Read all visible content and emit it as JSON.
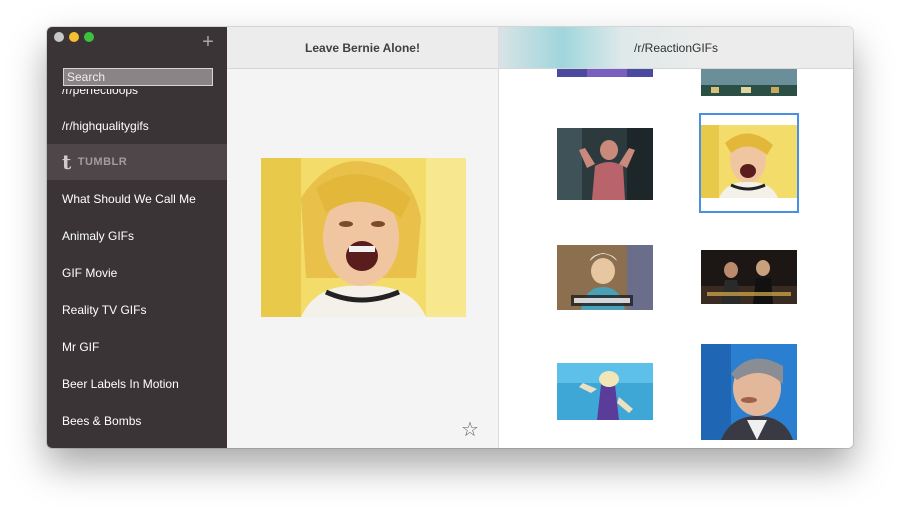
{
  "sidebar": {
    "add_icon": "plus-icon",
    "search_placeholder": "Search",
    "items": [
      {
        "label": "/r/perfectloops"
      },
      {
        "label": "/r/highqualitygifs"
      },
      {
        "label": "TUMBLR",
        "icon": "tumblr-icon"
      },
      {
        "label": "What Should We Call Me"
      },
      {
        "label": "Animaly GIFs"
      },
      {
        "label": "GIF Movie"
      },
      {
        "label": "Reality TV GIFs"
      },
      {
        "label": "Mr GIF"
      },
      {
        "label": "Beer Labels In Motion"
      },
      {
        "label": "Bees & Bombs"
      }
    ]
  },
  "detail": {
    "title": "Leave Bernie Alone!",
    "favorite_icon": "star-icon"
  },
  "grid": {
    "title": "/r/ReactionGIFs"
  },
  "colors": {
    "sidebar_bg": "#3b3437",
    "selection_outline": "#4a8fe7"
  }
}
